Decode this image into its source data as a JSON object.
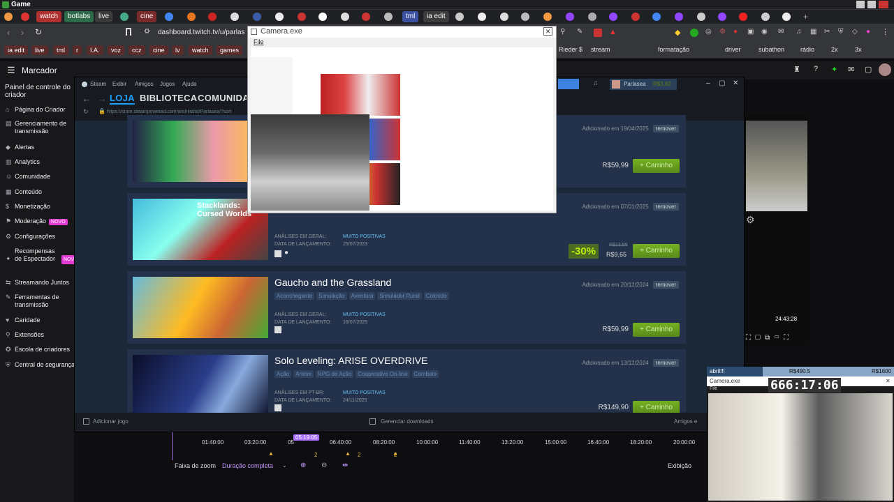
{
  "window": {
    "title": "Game"
  },
  "tabs": [
    "watch",
    "botlabs",
    "live",
    "cine",
    "tml",
    "ia edit"
  ],
  "address": {
    "url": "dashboard.twitch.tv/u/parlasea"
  },
  "bookmarks_left": [
    "ia edit",
    "live",
    "tml",
    "r",
    "I.A.",
    "voz",
    "ccz",
    "cine",
    "lv",
    "watch",
    "games"
  ],
  "bookmarks_right": [
    "Rieder $",
    "stream",
    "formatação",
    "driver",
    "subathon",
    "rádio",
    "2x",
    "3x"
  ],
  "twitch": {
    "header": "Marcador",
    "sidebar_title": "Painel de controle do criador",
    "sidebar": [
      {
        "label": "Página do Criador",
        "icon": "⌂"
      },
      {
        "label": "Gerenciamento de transmissão",
        "icon": "▤"
      },
      {
        "label": "Alertas",
        "icon": "◆"
      },
      {
        "label": "Analytics",
        "icon": "▥"
      },
      {
        "label": "Comunidade",
        "icon": "☺"
      },
      {
        "label": "Conteúdo",
        "icon": "▦"
      },
      {
        "label": "Monetização",
        "icon": "$"
      },
      {
        "label": "Moderação",
        "icon": "⚑",
        "badge": "NOVO"
      },
      {
        "label": "Configurações",
        "icon": "⚙"
      },
      {
        "label": "Recompensas de Espectador",
        "icon": "✦",
        "badge": "NOVO"
      },
      {
        "label": "Streamando Juntos",
        "icon": "⇆"
      },
      {
        "label": "Ferramentas de transmissão",
        "icon": "✎"
      },
      {
        "label": "Caridade",
        "icon": "♥"
      },
      {
        "label": "Extensões",
        "icon": "⚲"
      },
      {
        "label": "Escola de criadores",
        "icon": "✪"
      },
      {
        "label": "Central de segurança",
        "icon": "⛨"
      }
    ]
  },
  "steam": {
    "menu": [
      "Steam",
      "Exibir",
      "Amigos",
      "Jogos",
      "Ajuda"
    ],
    "nav": [
      "LOJA",
      "BIBLIOTECA",
      "COMUNIDADE"
    ],
    "user": "Parlasea",
    "balance": "R$3,82",
    "url": "https://store.steampowered.com/wishlist/id/Parlasea/?sort",
    "items": [
      {
        "name": "",
        "added": "Adicionado em 19/04/2025",
        "price": "R$59,99",
        "tags": [],
        "review_label": "",
        "review": "",
        "release_label": "",
        "release": ""
      },
      {
        "name": "Stacklands: Cursed Worlds",
        "added": "Adicionado em 07/01/2025",
        "discount": "-30%",
        "old_price": "R$13,99",
        "price": "R$9,65",
        "tags": [],
        "review_label": "ANÁLISES EM GERAL:",
        "review": "MUITO POSITIVAS",
        "release_label": "DATA DE LANÇAMENTO:",
        "release": "25/07/2023"
      },
      {
        "name": "Gaucho and the Grassland",
        "added": "Adicionado em 20/12/2024",
        "price": "R$59,99",
        "tags": [
          "Aconchegante",
          "Simulação",
          "Aventura",
          "Simulador Rural",
          "Colorido"
        ],
        "review_label": "ANÁLISES EM GERAL:",
        "review": "MUITO POSITIVAS",
        "release_label": "DATA DE LANÇAMENTO:",
        "release": "16/07/2025"
      },
      {
        "name": "Solo Leveling: ARISE OVERDRIVE",
        "added": "Adicionado em 13/12/2024",
        "price": "R$149,90",
        "tags": [
          "Ação",
          "Anime",
          "RPG de Ação",
          "Cooperativo On-line",
          "Combate"
        ],
        "review_label": "ANÁLISES EM PT-BR:",
        "review": "MUITO POSITIVAS",
        "release_label": "DATA DE LANÇAMENTO:",
        "release": "24/11/2025"
      }
    ],
    "remove": "remover",
    "cart": "+ Carrinho",
    "add_game": "Adicionar jogo",
    "downloads": "Gerenciar downloads",
    "friends": "Amigos e"
  },
  "timeline": {
    "ticks": [
      "01:40:00",
      "03:20:00",
      "05",
      "06:40:00",
      "08:20:00",
      "10:00:00",
      "11:40:00",
      "13:20:00",
      "15:00:00",
      "16:40:00",
      "18:20:00",
      "20:00:00"
    ],
    "cursor": "05:19:05",
    "zoom_label": "Faixa de zoom",
    "zoom_value": "Duração completa",
    "view": "Exibição",
    "markers": [
      "2",
      "2",
      "2"
    ]
  },
  "camera": {
    "title": "Camera.exe",
    "menu": "File"
  },
  "cam2": {
    "title": "Camera.exe",
    "menu": "File",
    "top_left": "abril!!!",
    "top_mid": "R$490.5",
    "top_right": "R$1600",
    "timer": "666:17:06"
  },
  "right_panel": {
    "timer": "24:43:28"
  }
}
